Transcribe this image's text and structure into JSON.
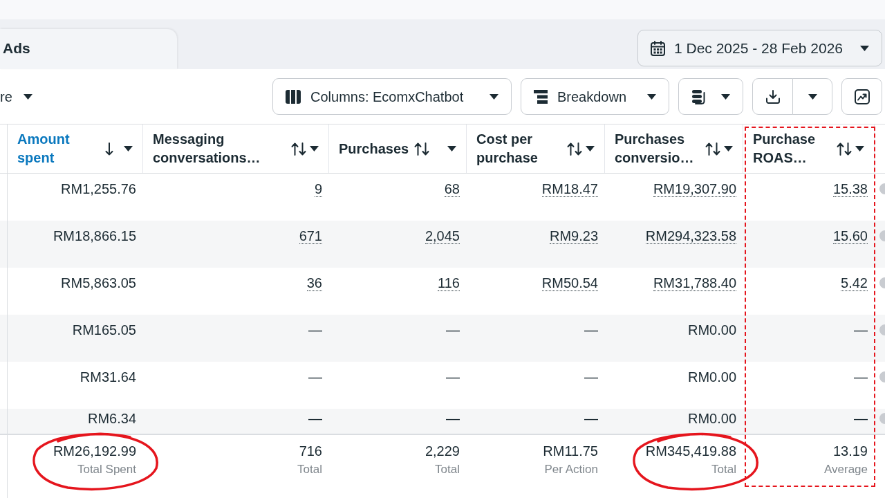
{
  "tab": {
    "label": "Ads"
  },
  "date_range": {
    "label": "1 Dec 2025 - 28 Feb 2026"
  },
  "toolbar": {
    "dropdown": {
      "label": "re"
    },
    "buttons": [
      {
        "kind": "columns",
        "label": "Columns: EcomxChatbot"
      },
      {
        "kind": "breakdown",
        "label": "Breakdown"
      },
      {
        "kind": "stack"
      },
      {
        "kind": "export"
      },
      {
        "kind": "chart"
      }
    ]
  },
  "table": {
    "columns": [
      {
        "label": "Amount spent",
        "sorted": true,
        "highlighted": false
      },
      {
        "label": "Messaging conversations…",
        "sorted": false,
        "highlighted": false
      },
      {
        "label": "Purchases",
        "sorted": false,
        "highlighted": false
      },
      {
        "label": "Cost per purchase",
        "sorted": false,
        "highlighted": false
      },
      {
        "label": "Purchases conversio…",
        "sorted": false,
        "highlighted": false
      },
      {
        "label": "Purchase ROAS…",
        "sorted": false,
        "highlighted": true
      }
    ],
    "rows": [
      {
        "cells": [
          {
            "text": "RM1,255.76",
            "linked": false
          },
          {
            "text": "9",
            "linked": true
          },
          {
            "text": "68",
            "linked": true
          },
          {
            "text": "RM18.47",
            "linked": true
          },
          {
            "text": "RM19,307.90",
            "linked": true
          },
          {
            "text": "15.38",
            "linked": true
          }
        ]
      },
      {
        "cells": [
          {
            "text": "RM18,866.15",
            "linked": false
          },
          {
            "text": "671",
            "linked": true
          },
          {
            "text": "2,045",
            "linked": true
          },
          {
            "text": "RM9.23",
            "linked": true
          },
          {
            "text": "RM294,323.58",
            "linked": true
          },
          {
            "text": "15.60",
            "linked": true
          }
        ]
      },
      {
        "cells": [
          {
            "text": "RM5,863.05",
            "linked": false
          },
          {
            "text": "36",
            "linked": true
          },
          {
            "text": "116",
            "linked": true
          },
          {
            "text": "RM50.54",
            "linked": true
          },
          {
            "text": "RM31,788.40",
            "linked": true
          },
          {
            "text": "5.42",
            "linked": true
          }
        ]
      },
      {
        "cells": [
          {
            "text": "RM165.05",
            "linked": false
          },
          {
            "text": "—",
            "linked": false
          },
          {
            "text": "—",
            "linked": false
          },
          {
            "text": "—",
            "linked": false
          },
          {
            "text": "RM0.00",
            "linked": false
          },
          {
            "text": "—",
            "linked": false
          }
        ]
      },
      {
        "cells": [
          {
            "text": "RM31.64",
            "linked": false
          },
          {
            "text": "—",
            "linked": false
          },
          {
            "text": "—",
            "linked": false
          },
          {
            "text": "—",
            "linked": false
          },
          {
            "text": "RM0.00",
            "linked": false
          },
          {
            "text": "—",
            "linked": false
          }
        ]
      },
      {
        "cells": [
          {
            "text": "RM6.34",
            "linked": false
          },
          {
            "text": "—",
            "linked": false
          },
          {
            "text": "—",
            "linked": false
          },
          {
            "text": "—",
            "linked": false
          },
          {
            "text": "RM0.00",
            "linked": false
          },
          {
            "text": "—",
            "linked": false
          }
        ]
      }
    ],
    "totals": [
      {
        "value": "RM26,192.99",
        "label": "Total Spent",
        "circled": true
      },
      {
        "value": "716",
        "label": "Total",
        "circled": false
      },
      {
        "value": "2,229",
        "label": "Total",
        "circled": false
      },
      {
        "value": "RM11.75",
        "label": "Per Action",
        "circled": false
      },
      {
        "value": "RM345,419.88",
        "label": "Total",
        "circled": true
      },
      {
        "value": "13.19",
        "label": "Average",
        "circled": false
      }
    ]
  }
}
